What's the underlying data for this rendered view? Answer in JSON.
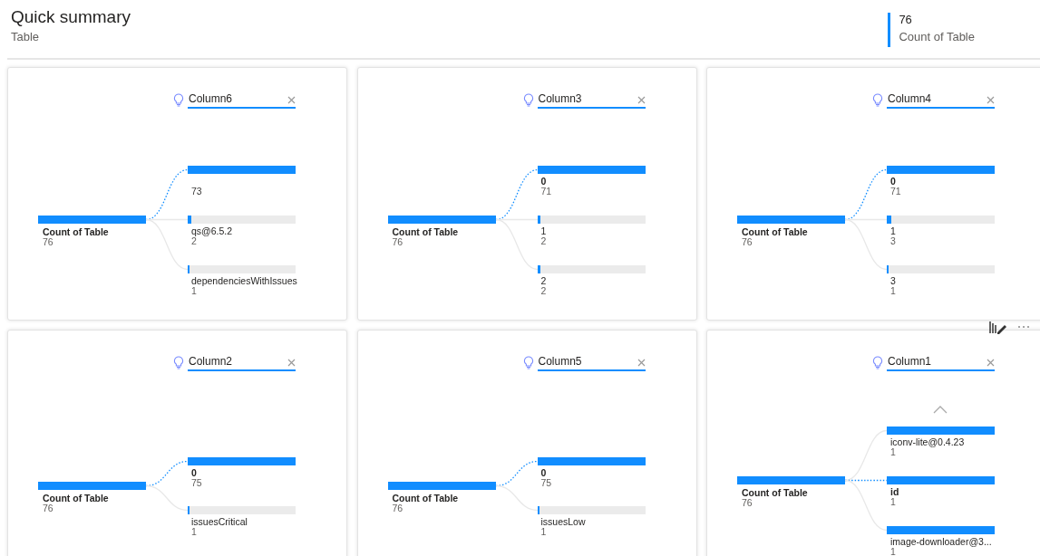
{
  "header": {
    "title": "Quick summary",
    "subtitle": "Table"
  },
  "kpi": {
    "value": "76",
    "label": "Count of Table"
  },
  "cards": [
    {
      "column": "Column6",
      "root": {
        "label": "Count of Table",
        "value": "76"
      },
      "children": [
        {
          "value": "73",
          "level": 1,
          "selected": true
        },
        {
          "label": "qs@6.5.2",
          "value": "2",
          "level": 0.03,
          "selected": false
        },
        {
          "label": "dependenciesWithIssues",
          "value": "1",
          "level": 0.014,
          "selected": false
        }
      ]
    },
    {
      "column": "Column3",
      "root": {
        "label": "Count of Table",
        "value": "76"
      },
      "children": [
        {
          "label": "0",
          "value": "71",
          "level": 1,
          "selected": true
        },
        {
          "label": "1",
          "value": "2",
          "level": 0.03,
          "selected": false
        },
        {
          "label": "2",
          "value": "2",
          "level": 0.03,
          "selected": false
        }
      ]
    },
    {
      "column": "Column4",
      "root": {
        "label": "Count of Table",
        "value": "76"
      },
      "toolbar": true,
      "children": [
        {
          "label": "0",
          "value": "71",
          "level": 1,
          "selected": true
        },
        {
          "label": "1",
          "value": "3",
          "level": 0.042,
          "selected": false
        },
        {
          "label": "3",
          "value": "1",
          "level": 0.014,
          "selected": false
        }
      ]
    },
    {
      "column": "Column2",
      "root": {
        "label": "Count of Table",
        "value": "76"
      },
      "children": [
        {
          "label": "0",
          "value": "75",
          "level": 1,
          "selected": true
        },
        {
          "label": "issuesCritical",
          "value": "1",
          "level": 0.013,
          "selected": false
        }
      ]
    },
    {
      "column": "Column5",
      "root": {
        "label": "Count of Table",
        "value": "76"
      },
      "children": [
        {
          "label": "0",
          "value": "75",
          "level": 1,
          "selected": true
        },
        {
          "label": "issuesLow",
          "value": "1",
          "level": 0.013,
          "selected": false
        }
      ]
    },
    {
      "column": "Column1",
      "root": {
        "label": "Count of Table",
        "value": "76"
      },
      "scroll_up": true,
      "children": [
        {
          "label": "iconv-lite@0.4.23",
          "value": "1",
          "level": 1,
          "selected": false
        },
        {
          "label": "id",
          "value": "1",
          "level": 1,
          "selected": true
        },
        {
          "label": "image-downloader@3...",
          "value": "1",
          "level": 1,
          "selected": false
        }
      ]
    }
  ]
}
